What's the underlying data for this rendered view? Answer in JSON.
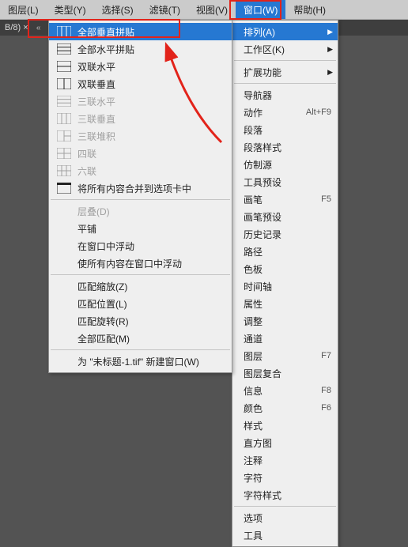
{
  "menubar": {
    "items": [
      {
        "label": "图层(L)"
      },
      {
        "label": "类型(Y)"
      },
      {
        "label": "选择(S)"
      },
      {
        "label": "滤镜(T)"
      },
      {
        "label": "视图(V)"
      },
      {
        "label": "窗口(W)"
      },
      {
        "label": "帮助(H)"
      }
    ],
    "activeIndex": 5
  },
  "tabbar": {
    "left": "B/8) ×",
    "chev": "«"
  },
  "windowMenu": {
    "rows": [
      {
        "type": "item",
        "label": "排列(A)",
        "arrow": true,
        "hover": true
      },
      {
        "type": "item",
        "label": "工作区(K)",
        "arrow": true
      },
      {
        "type": "sep"
      },
      {
        "type": "item",
        "label": "扩展功能",
        "arrow": true
      },
      {
        "type": "sep"
      },
      {
        "type": "item",
        "label": "导航器"
      },
      {
        "type": "item",
        "label": "动作",
        "shortcut": "Alt+F9"
      },
      {
        "type": "item",
        "label": "段落"
      },
      {
        "type": "item",
        "label": "段落样式"
      },
      {
        "type": "item",
        "label": "仿制源"
      },
      {
        "type": "item",
        "label": "工具预设"
      },
      {
        "type": "item",
        "label": "画笔",
        "shortcut": "F5"
      },
      {
        "type": "item",
        "label": "画笔预设"
      },
      {
        "type": "item",
        "label": "历史记录"
      },
      {
        "type": "item",
        "label": "路径"
      },
      {
        "type": "item",
        "label": "色板"
      },
      {
        "type": "item",
        "label": "时间轴"
      },
      {
        "type": "item",
        "label": "属性"
      },
      {
        "type": "item",
        "label": "调整"
      },
      {
        "type": "item",
        "label": "通道"
      },
      {
        "type": "item",
        "label": "图层",
        "shortcut": "F7"
      },
      {
        "type": "item",
        "label": "图层复合"
      },
      {
        "type": "item",
        "label": "信息",
        "shortcut": "F8"
      },
      {
        "type": "item",
        "label": "颜色",
        "shortcut": "F6"
      },
      {
        "type": "item",
        "label": "样式"
      },
      {
        "type": "item",
        "label": "直方图"
      },
      {
        "type": "item",
        "label": "注释"
      },
      {
        "type": "item",
        "label": "字符"
      },
      {
        "type": "item",
        "label": "字符样式"
      },
      {
        "type": "sep"
      },
      {
        "type": "item",
        "label": "选项"
      },
      {
        "type": "item",
        "label": "工具"
      }
    ]
  },
  "arrangeMenu": {
    "rows": [
      {
        "type": "item",
        "icon": "vert-all",
        "label": "全部垂直拼贴",
        "hover": true
      },
      {
        "type": "item",
        "icon": "horz-all",
        "label": "全部水平拼贴"
      },
      {
        "type": "item",
        "icon": "two-h",
        "label": "双联水平"
      },
      {
        "type": "item",
        "icon": "two-v",
        "label": "双联垂直"
      },
      {
        "type": "item",
        "icon": "three-h",
        "label": "三联水平",
        "dis": true
      },
      {
        "type": "item",
        "icon": "three-v",
        "label": "三联垂直",
        "dis": true
      },
      {
        "type": "item",
        "icon": "three-stack",
        "label": "三联堆积",
        "dis": true
      },
      {
        "type": "item",
        "icon": "four",
        "label": "四联",
        "dis": true
      },
      {
        "type": "item",
        "icon": "six",
        "label": "六联",
        "dis": true
      },
      {
        "type": "item",
        "icon": "consolidate",
        "label": "将所有内容合并到选项卡中"
      },
      {
        "type": "sep"
      },
      {
        "type": "item",
        "noicon": true,
        "label": "层叠(D)",
        "dis": true
      },
      {
        "type": "item",
        "noicon": true,
        "label": "平铺"
      },
      {
        "type": "item",
        "noicon": true,
        "label": "在窗口中浮动"
      },
      {
        "type": "item",
        "noicon": true,
        "label": "使所有内容在窗口中浮动"
      },
      {
        "type": "sep"
      },
      {
        "type": "item",
        "noicon": true,
        "label": "匹配缩放(Z)"
      },
      {
        "type": "item",
        "noicon": true,
        "label": "匹配位置(L)"
      },
      {
        "type": "item",
        "noicon": true,
        "label": "匹配旋转(R)"
      },
      {
        "type": "item",
        "noicon": true,
        "label": "全部匹配(M)"
      },
      {
        "type": "sep"
      },
      {
        "type": "item",
        "noicon": true,
        "label": "为 \"未标题-1.tif\" 新建窗口(W)"
      }
    ]
  }
}
